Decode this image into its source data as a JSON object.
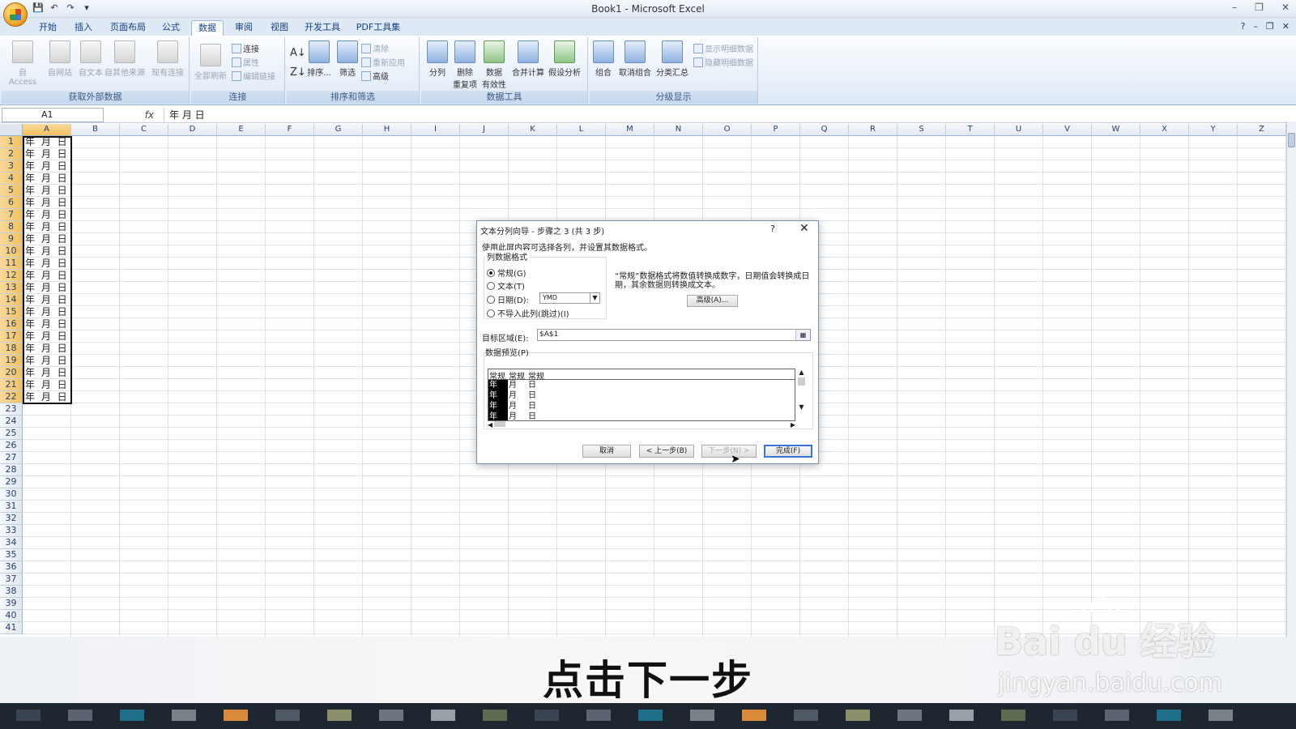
{
  "window": {
    "title": "Book1 - Microsoft Excel",
    "controls": [
      "–",
      "❐",
      "✕"
    ]
  },
  "qat_icons": [
    "save-icon",
    "undo-icon",
    "redo-icon",
    "customize-icon"
  ],
  "tabs": [
    "开始",
    "插入",
    "页面布局",
    "公式",
    "数据",
    "审阅",
    "视图",
    "开发工具",
    "PDF工具集"
  ],
  "active_tab": "数据",
  "ribbon": {
    "groups": [
      {
        "label": "获取外部数据",
        "buttons": [
          "自 Access",
          "自网站",
          "自文本",
          "自其他来源",
          "现有连接"
        ]
      },
      {
        "label": "连接",
        "big": "全部刷新",
        "small": [
          "连接",
          "属性",
          "编辑链接"
        ]
      },
      {
        "label": "排序和筛选",
        "big": [
          "排序...",
          "筛选"
        ],
        "small": [
          "清除",
          "重新应用",
          "高级"
        ]
      },
      {
        "label": "数据工具",
        "buttons": [
          "分列",
          "删除\n重复项",
          "数据\n有效性",
          "合并计算",
          "假设分析"
        ]
      },
      {
        "label": "分级显示",
        "buttons": [
          "组合",
          "取消组合",
          "分类汇总"
        ],
        "small": [
          "显示明细数据",
          "隐藏明细数据"
        ]
      }
    ]
  },
  "formula_bar": {
    "name_box": "A1",
    "fx": "fx",
    "content": "年 月 日"
  },
  "sheet": {
    "columns": [
      "A",
      "B",
      "C",
      "D",
      "E",
      "F",
      "G",
      "H",
      "I",
      "J",
      "K",
      "L",
      "M",
      "N",
      "O",
      "P",
      "Q",
      "R",
      "S",
      "T",
      "U",
      "V",
      "W",
      "X",
      "Y",
      "Z"
    ],
    "rows": [
      "1",
      "2",
      "3",
      "4",
      "5",
      "6",
      "7",
      "8",
      "9",
      "10",
      "11",
      "12",
      "13",
      "14",
      "15",
      "16",
      "17",
      "18",
      "19",
      "20",
      "21",
      "22",
      "23",
      "24",
      "25",
      "26",
      "27",
      "28",
      "29",
      "30",
      "31",
      "32",
      "33",
      "34",
      "35",
      "36",
      "37",
      "38",
      "39",
      "40",
      "41"
    ],
    "colA": [
      "年 月 日",
      "年 月 日",
      "年 月 日",
      "年 月 日",
      "年 月 日",
      "年 月 日",
      "年 月 日",
      "年 月 日",
      "年 月 日",
      "年 月 日",
      "年 月 日",
      "年 月 日",
      "年 月 日",
      "年 月 日",
      "年 月 日",
      "年 月 日",
      "年 月 日",
      "年 月 日",
      "年 月 日",
      "年 月 日",
      "年 月 日",
      "年 月 日"
    ]
  },
  "dialog": {
    "title": "文本分列向导 - 步骤之 3 (共 3 步)",
    "help": "?",
    "close": "✕",
    "instruction": "使用此屏内容可选择各列，并设置其数据格式。",
    "format_legend": "列数据格式",
    "options": [
      "常规(G)",
      "文本(T)",
      "日期(D):",
      "不导入此列(跳过)(I)"
    ],
    "selected_option": "常规(G)",
    "date_format": "YMD",
    "description": "“常规”数据格式将数值转换成数字，日期值会转换成日期，其余数据则转换成文本。",
    "advanced_button": "高级(A)...",
    "destination_label": "目标区域(E):",
    "destination_value": "$A$1",
    "preview_label": "数据预览(P)",
    "preview_headers": [
      "常规",
      "常规",
      "常规"
    ],
    "preview_rows": [
      [
        "年",
        "月",
        "日"
      ],
      [
        "年",
        "月",
        "日"
      ],
      [
        "年",
        "月",
        "日"
      ],
      [
        "年",
        "月",
        "日"
      ]
    ],
    "buttons": {
      "cancel": "取消",
      "back": "< 上一步(B)",
      "next": "下一步(N) >",
      "finish": "完成(F)"
    }
  },
  "caption": "点击下一步",
  "watermark": {
    "brand": "Bai du 经验",
    "url": "jingyan.baidu.com"
  },
  "colors": {
    "ribbon_blue": "#dde8f5",
    "tab_text": "#15428b",
    "selection_header": "#f1c15f",
    "default_button_border": "#3875d7"
  }
}
